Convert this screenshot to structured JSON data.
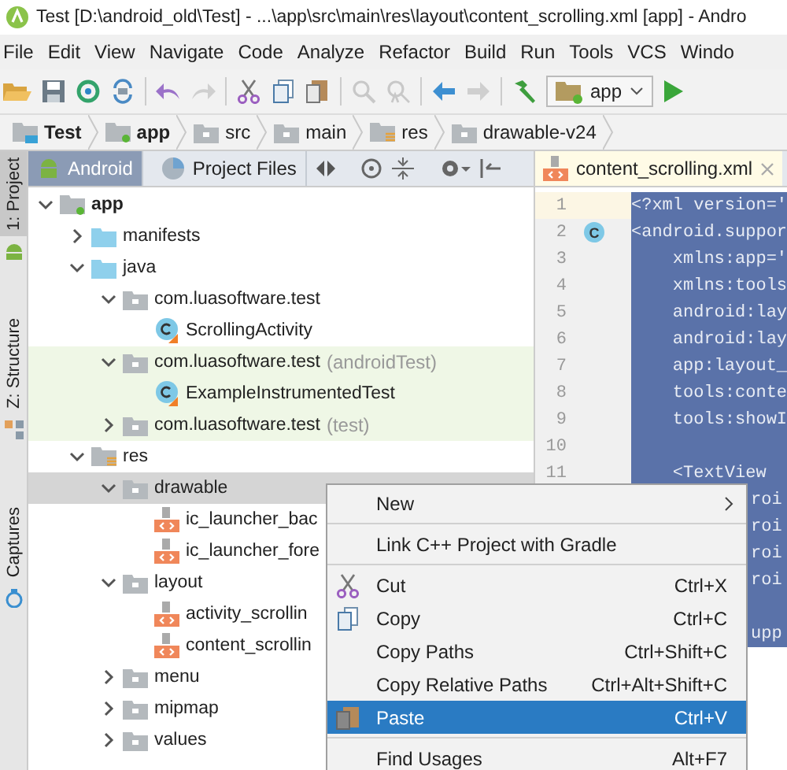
{
  "title": "Test [D:\\android_old\\Test] - ...\\app\\src\\main\\res\\layout\\content_scrolling.xml [app] - Andro",
  "menu_bar": [
    "File",
    "Edit",
    "View",
    "Navigate",
    "Code",
    "Analyze",
    "Refactor",
    "Build",
    "Run",
    "Tools",
    "VCS",
    "Windo"
  ],
  "toolbar": {
    "run_config": "app"
  },
  "breadcrumbs": [
    {
      "label": "Test",
      "kind": "project"
    },
    {
      "label": "app",
      "kind": "module"
    },
    {
      "label": "src",
      "kind": "folder"
    },
    {
      "label": "main",
      "kind": "folder"
    },
    {
      "label": "res",
      "kind": "res"
    },
    {
      "label": "drawable-v24",
      "kind": "folder"
    }
  ],
  "side_tabs": [
    {
      "label": "1: Project",
      "selected": true,
      "kind": "project"
    },
    {
      "label": "Z: Structure",
      "selected": false,
      "kind": "structure"
    },
    {
      "label": "Captures",
      "selected": false,
      "kind": "captures"
    }
  ],
  "project_view": {
    "tabs": [
      {
        "label": "Android",
        "selected": true,
        "kind": "android"
      },
      {
        "label": "Project Files",
        "selected": false,
        "kind": "files"
      }
    ],
    "tree": [
      {
        "label": "app",
        "kind": "module",
        "expanded": true,
        "selected": false,
        "highlighted": false,
        "children": [
          {
            "label": "manifests",
            "kind": "folder",
            "expanded": false,
            "selected": false,
            "highlighted": false
          },
          {
            "label": "java",
            "kind": "folder",
            "expanded": true,
            "selected": false,
            "highlighted": false,
            "children": [
              {
                "label": "com.luasoftware.test",
                "kind": "package",
                "expanded": true,
                "selected": false,
                "highlighted": false,
                "children": [
                  {
                    "label": "ScrollingActivity",
                    "kind": "class",
                    "selected": false,
                    "highlighted": false
                  }
                ]
              },
              {
                "label": "com.luasoftware.test",
                "suffix": "(androidTest)",
                "kind": "package",
                "expanded": true,
                "selected": false,
                "highlighted": true,
                "children": [
                  {
                    "label": "ExampleInstrumentedTest",
                    "kind": "class",
                    "selected": false,
                    "highlighted": true
                  }
                ]
              },
              {
                "label": "com.luasoftware.test",
                "suffix": "(test)",
                "kind": "package",
                "expanded": false,
                "selected": false,
                "highlighted": true
              }
            ]
          },
          {
            "label": "res",
            "kind": "res",
            "expanded": true,
            "selected": false,
            "highlighted": false,
            "children": [
              {
                "label": "drawable",
                "kind": "package",
                "expanded": true,
                "selected": true,
                "highlighted": false,
                "children": [
                  {
                    "label": "ic_launcher_bac",
                    "kind": "xml",
                    "selected": false,
                    "highlighted": false
                  },
                  {
                    "label": "ic_launcher_fore",
                    "kind": "xml",
                    "selected": false,
                    "highlighted": false
                  }
                ]
              },
              {
                "label": "layout",
                "kind": "package",
                "expanded": true,
                "selected": false,
                "highlighted": false,
                "children": [
                  {
                    "label": "activity_scrollin",
                    "kind": "xml",
                    "selected": false,
                    "highlighted": false
                  },
                  {
                    "label": "content_scrollin",
                    "kind": "xml",
                    "selected": false,
                    "highlighted": false
                  }
                ]
              },
              {
                "label": "menu",
                "kind": "package",
                "expanded": false,
                "selected": false,
                "highlighted": false
              },
              {
                "label": "mipmap",
                "kind": "package",
                "expanded": false,
                "selected": false,
                "highlighted": false
              },
              {
                "label": "values",
                "kind": "package",
                "expanded": false,
                "selected": false,
                "highlighted": false
              }
            ]
          }
        ]
      }
    ]
  },
  "editor": {
    "tabs": [
      {
        "label": "content_scrolling.xml",
        "selected": true
      }
    ],
    "lines": [
      {
        "kind": "line",
        "number": "1",
        "code": "<?xml version='",
        "current": true
      },
      {
        "kind": "line",
        "number": "2",
        "code": "<android.suppor",
        "current": false,
        "badge": "C"
      },
      {
        "kind": "line",
        "number": "3",
        "code": "    xmlns:app='",
        "current": false
      },
      {
        "kind": "line",
        "number": "4",
        "code": "    xmlns:tools",
        "current": false
      },
      {
        "kind": "line",
        "number": "5",
        "code": "    android:lay",
        "current": false
      },
      {
        "kind": "line",
        "number": "6",
        "code": "    android:lay",
        "current": false
      },
      {
        "kind": "line",
        "number": "7",
        "code": "    app:layout_",
        "current": false
      },
      {
        "kind": "line",
        "number": "8",
        "code": "    tools:conte",
        "current": false
      },
      {
        "kind": "line",
        "number": "9",
        "code": "    tools:showI",
        "current": false
      },
      {
        "kind": "line",
        "number": "10",
        "current": false
      },
      {
        "kind": "line",
        "number": "11",
        "code": "    <TextView",
        "current": false
      },
      {
        "kind": "covered",
        "code": "roi"
      },
      {
        "kind": "covered",
        "code": "roi"
      },
      {
        "kind": "covered",
        "code": "roi"
      },
      {
        "kind": "covered",
        "code": "roi"
      },
      {
        "kind": "covered"
      },
      {
        "kind": "covered",
        "code": "upp"
      }
    ]
  },
  "context_menu": [
    {
      "kind": "plain",
      "label": "New",
      "submenu": true,
      "selected": false
    },
    {
      "kind": "separator"
    },
    {
      "kind": "plain",
      "label": "Link C++ Project with Gradle",
      "submenu": false,
      "selected": false
    },
    {
      "kind": "separator"
    },
    {
      "kind": "cut",
      "label": "Cut",
      "shortcut": "Ctrl+X",
      "submenu": false,
      "selected": false
    },
    {
      "kind": "copy",
      "label": "Copy",
      "shortcut": "Ctrl+C",
      "submenu": false,
      "selected": false
    },
    {
      "kind": "plain",
      "label": "Copy Paths",
      "shortcut": "Ctrl+Shift+C",
      "submenu": false,
      "selected": false
    },
    {
      "kind": "plain",
      "label": "Copy Relative Paths",
      "shortcut": "Ctrl+Alt+Shift+C",
      "submenu": false,
      "selected": false
    },
    {
      "kind": "paste",
      "label": "Paste",
      "shortcut": "Ctrl+V",
      "submenu": false,
      "selected": true
    },
    {
      "kind": "separator"
    },
    {
      "kind": "plain",
      "label": "Find Usages",
      "shortcut": "Alt+F7",
      "submenu": false,
      "selected": false
    }
  ]
}
